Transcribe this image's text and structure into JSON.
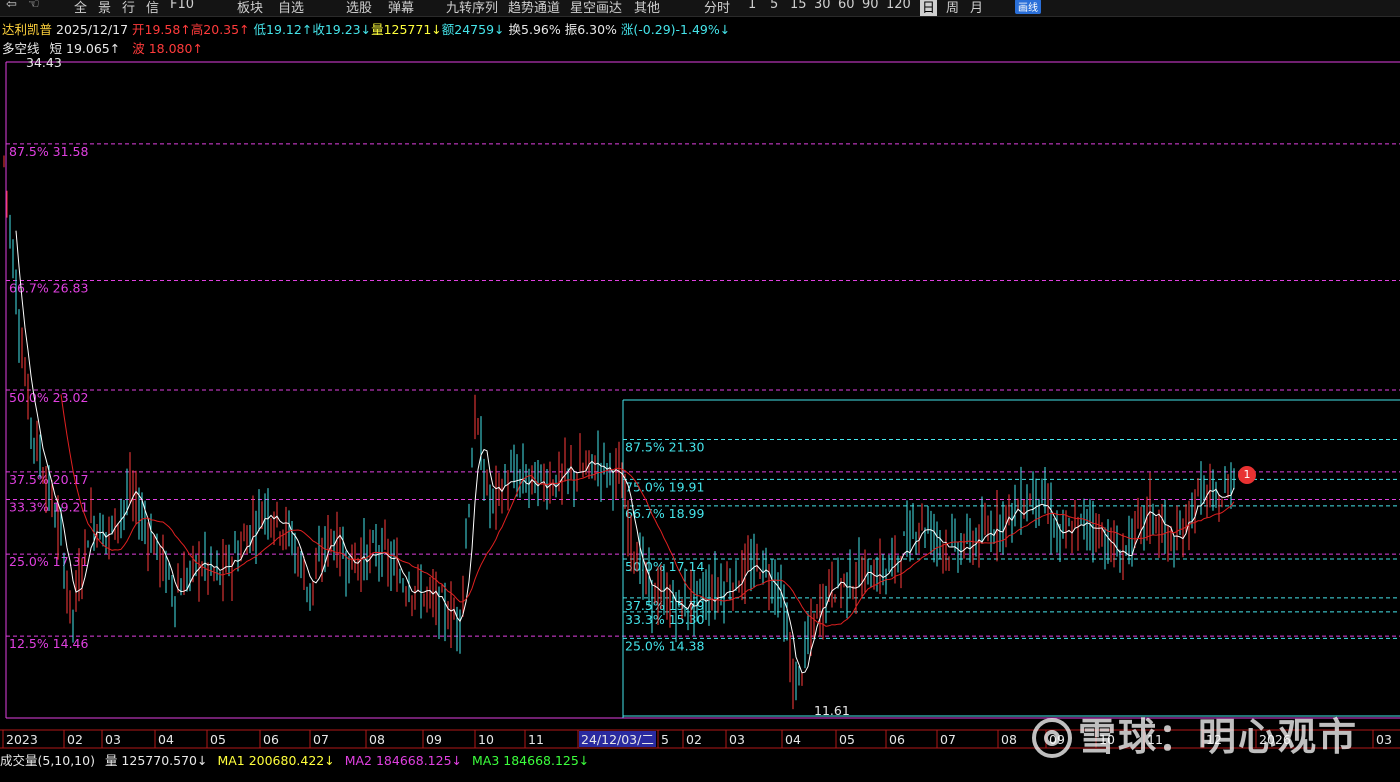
{
  "toolbar": {
    "items": [
      "全",
      "景",
      "行",
      "信",
      "F10",
      "板块",
      "自选",
      "选股",
      "弹幕",
      "九转序列",
      "趋势通道",
      "星空画达",
      "其他",
      "分时",
      "1",
      "5",
      "15",
      "30",
      "60",
      "90",
      "120",
      "日",
      "周",
      "月",
      "画线"
    ]
  },
  "info": {
    "name": "达利凯普",
    "date": "2025/12/17",
    "open": "开19.58↑",
    "high": "高20.35↑",
    "low": "低19.12↑",
    "close": "收19.23↓",
    "volume": "量125771↓",
    "amount": "额24759↓",
    "turnover": "换5.96%",
    "amplitude": "振6.30%",
    "change": "涨(-0.29)-1.49%↓"
  },
  "indicator": {
    "name": "多空线",
    "short_label": "短",
    "short_value": "19.065↑",
    "wave_label": "波",
    "wave_value": "18.080↑"
  },
  "chart_data": {
    "type": "candlestick",
    "price_max_label": "34.43",
    "price_min_label": "11.61",
    "fib_left": [
      {
        "pct": "87.5%",
        "value": "31.58"
      },
      {
        "pct": "66.7%",
        "value": "26.83"
      },
      {
        "pct": "50.0%",
        "value": "23.02"
      },
      {
        "pct": "37.5%",
        "value": "20.17"
      },
      {
        "pct": "33.3%",
        "value": "19.21"
      },
      {
        "pct": "25.0%",
        "value": "17.31"
      },
      {
        "pct": "12.5%",
        "value": "14.46"
      }
    ],
    "fib_right": [
      {
        "pct": "87.5%",
        "value": "21.30"
      },
      {
        "pct": "75.0%",
        "value": "19.91"
      },
      {
        "pct": "66.7%",
        "value": "18.99"
      },
      {
        "pct": "50.0%",
        "value": "17.14"
      },
      {
        "pct": "37.5%",
        "value": "15.79"
      },
      {
        "pct": "33.3%",
        "value": "15.30"
      },
      {
        "pct": "25.0%",
        "value": "14.38"
      }
    ],
    "x_labels": [
      "2023",
      "02",
      "03",
      "04",
      "05",
      "06",
      "07",
      "08",
      "09",
      "10",
      "11",
      "24/12/03/二",
      "5",
      "02",
      "03",
      "04",
      "05",
      "06",
      "07",
      "08",
      "09",
      "10",
      "11",
      "12",
      "2026",
      "03"
    ],
    "badge": "1"
  },
  "volume_bar": {
    "title": "成交量(5,10,10)",
    "vol": "量 125770.570↓",
    "ma1": "MA1 200680.422↓",
    "ma2": "MA2 184668.125↓",
    "ma3": "MA3 184668.125↓"
  },
  "watermark": "雪球：明心观市",
  "colors": {
    "up": "#ff3b3b",
    "down": "#45e4ea",
    "fib_left": "#e040e0",
    "fib_right": "#45e4ea",
    "ma_white": "#ffffff",
    "ma_red": "#e02020"
  }
}
